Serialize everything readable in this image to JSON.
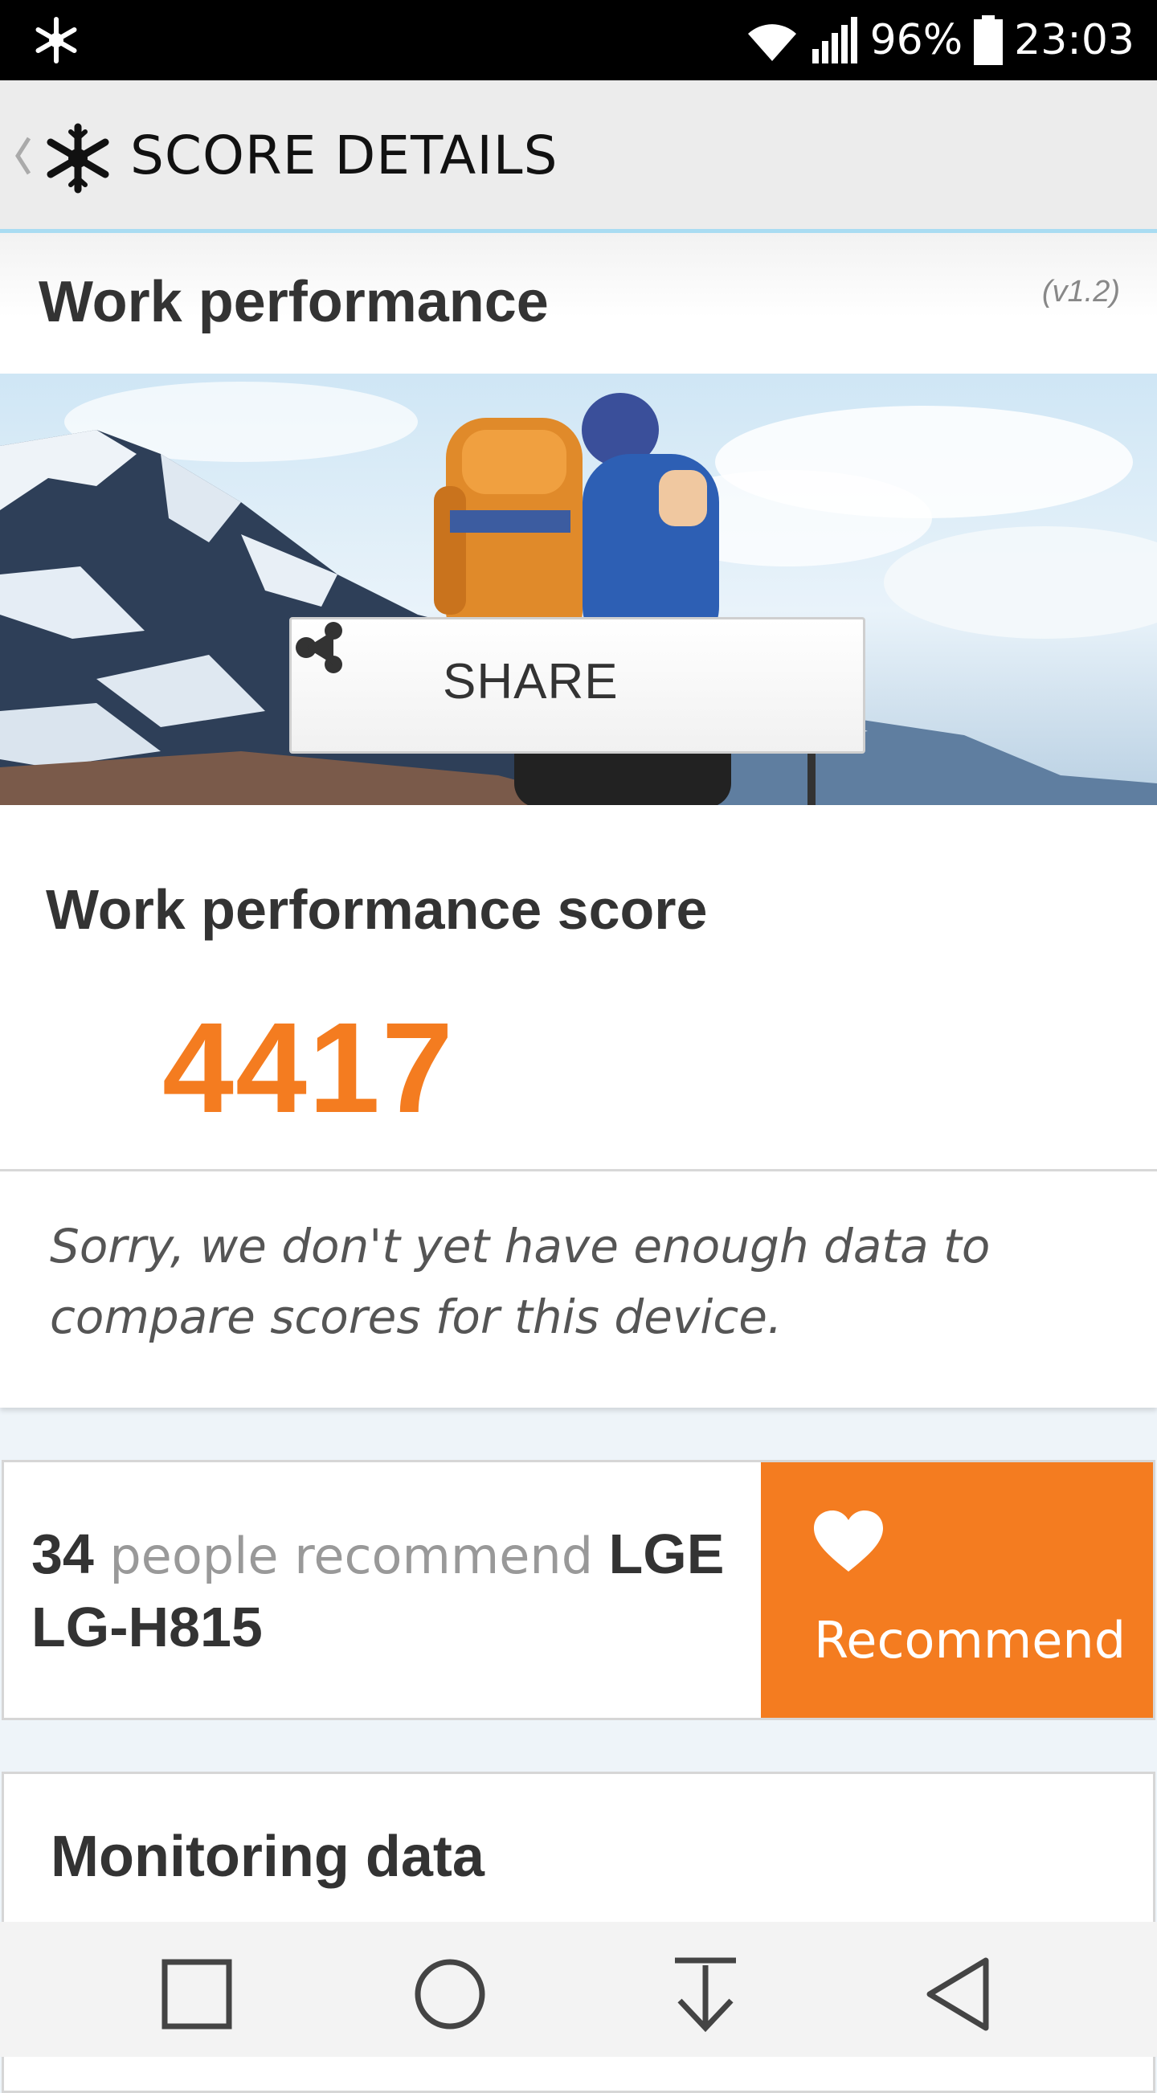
{
  "status_bar": {
    "battery": "96%",
    "time": "23:03",
    "left_icon": "snowflake-icon"
  },
  "app_bar": {
    "title": "SCORE DETAILS",
    "back_icon": "chevron-left-icon",
    "logo_icon": "snowflake-icon"
  },
  "section": {
    "title": "Work performance",
    "version": "(v1.2)"
  },
  "share": {
    "label": "SHARE",
    "icon": "share-icon"
  },
  "score": {
    "title": "Work performance score",
    "value": "4417",
    "note": "Sorry, we don't yet have enough data to compare scores for this device."
  },
  "recommend": {
    "count": "34",
    "middle": "people recommend",
    "device": "LGE LG-H815",
    "button_label": "Recommend",
    "icon": "heart-icon"
  },
  "monitoring": {
    "title": "Monitoring data"
  },
  "colors": {
    "accent": "#f47c20",
    "app_bar_border": "#a9dcf2",
    "background": "#eef4f9"
  }
}
